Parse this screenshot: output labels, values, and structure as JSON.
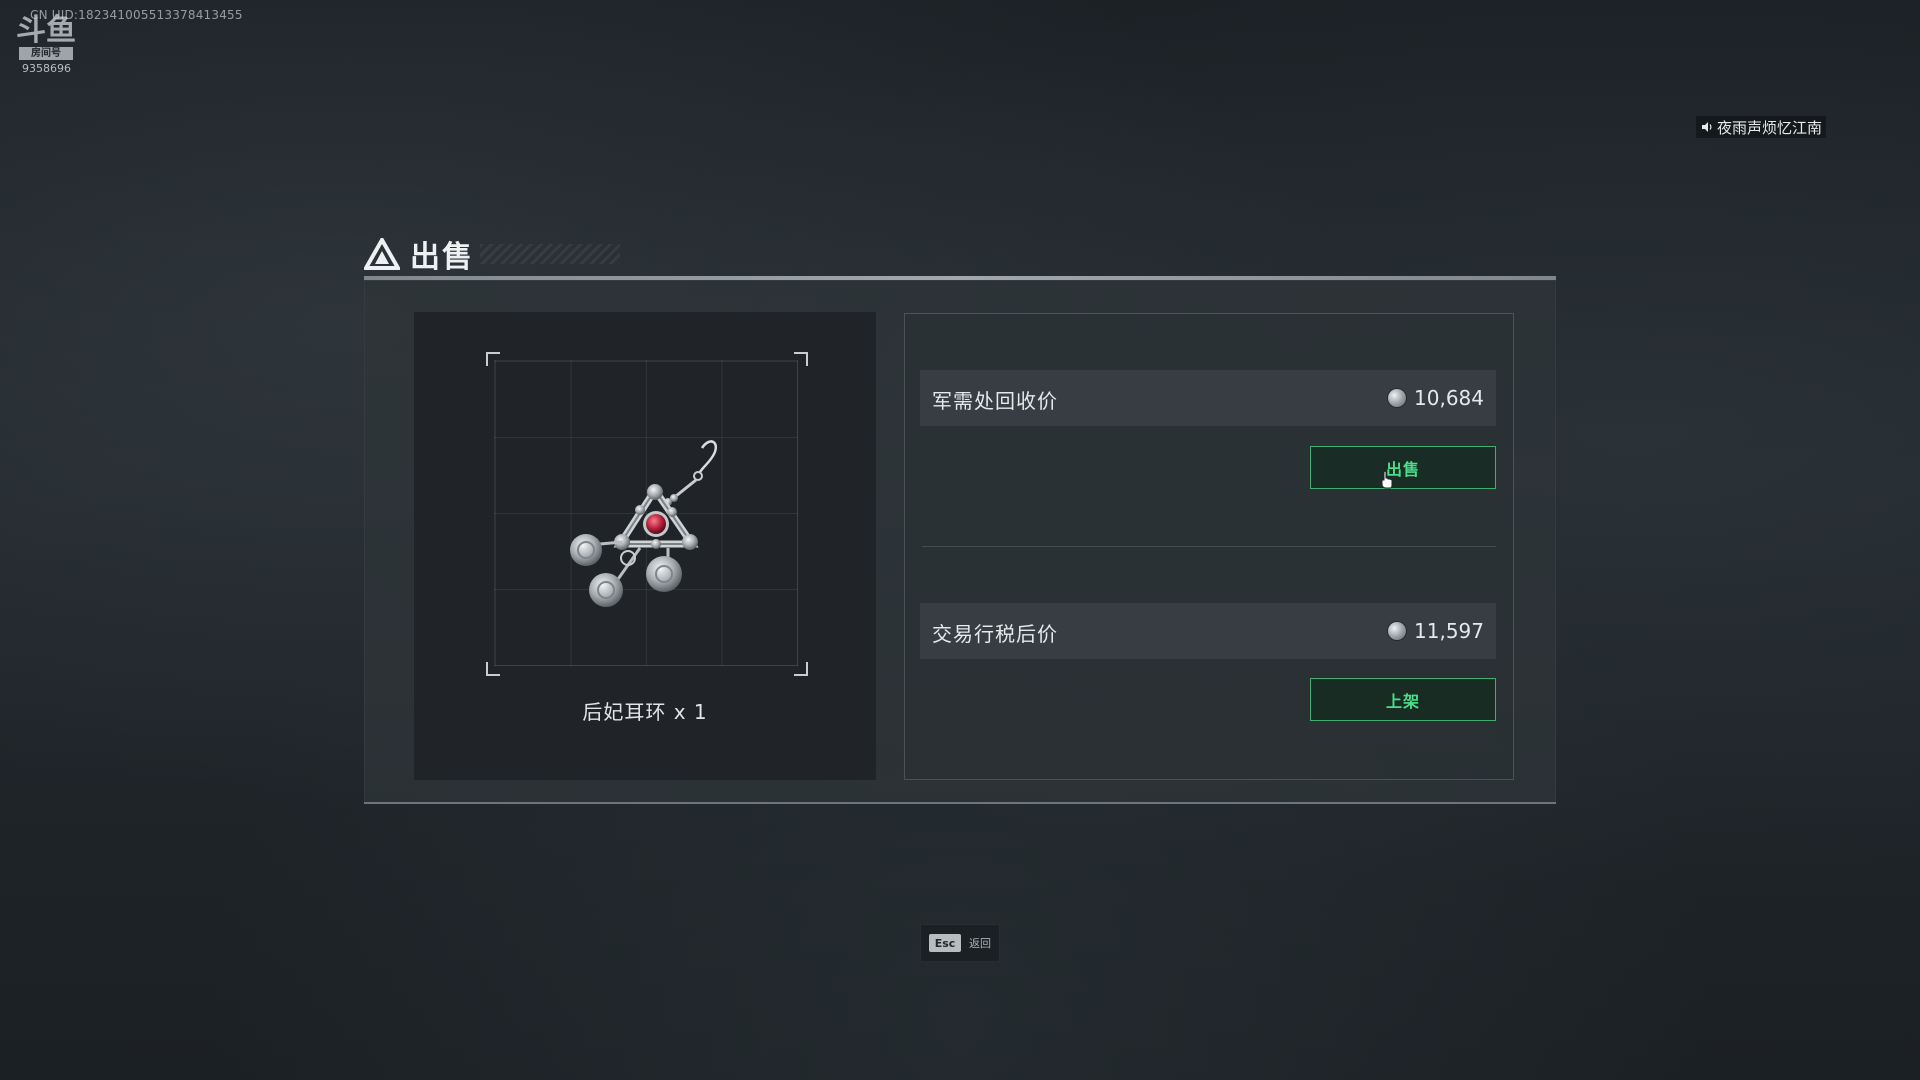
{
  "watermark": {
    "uid": "CN UID:18234100551337841345​5",
    "logo_glyph": "斗鱼",
    "logo_tag": "房间号",
    "room_number": "9358696"
  },
  "music": {
    "icon": "speaker-icon",
    "track": "夜雨声烦忆江南"
  },
  "dialog": {
    "title": "出售",
    "title_icon": "delta-logo-icon",
    "item": {
      "name": "后妃耳环 x 1",
      "icon": "earring-icon"
    },
    "options": [
      {
        "label": "军需处回收价",
        "price": "10,684",
        "currency_icon": "silver-coin-icon",
        "button": "出售"
      },
      {
        "label": "交易行税后价",
        "price": "11,597",
        "currency_icon": "silver-coin-icon",
        "button": "上架"
      }
    ],
    "accent_color": "#45e08a"
  },
  "footer": {
    "key": "Esc",
    "action": "返回"
  }
}
